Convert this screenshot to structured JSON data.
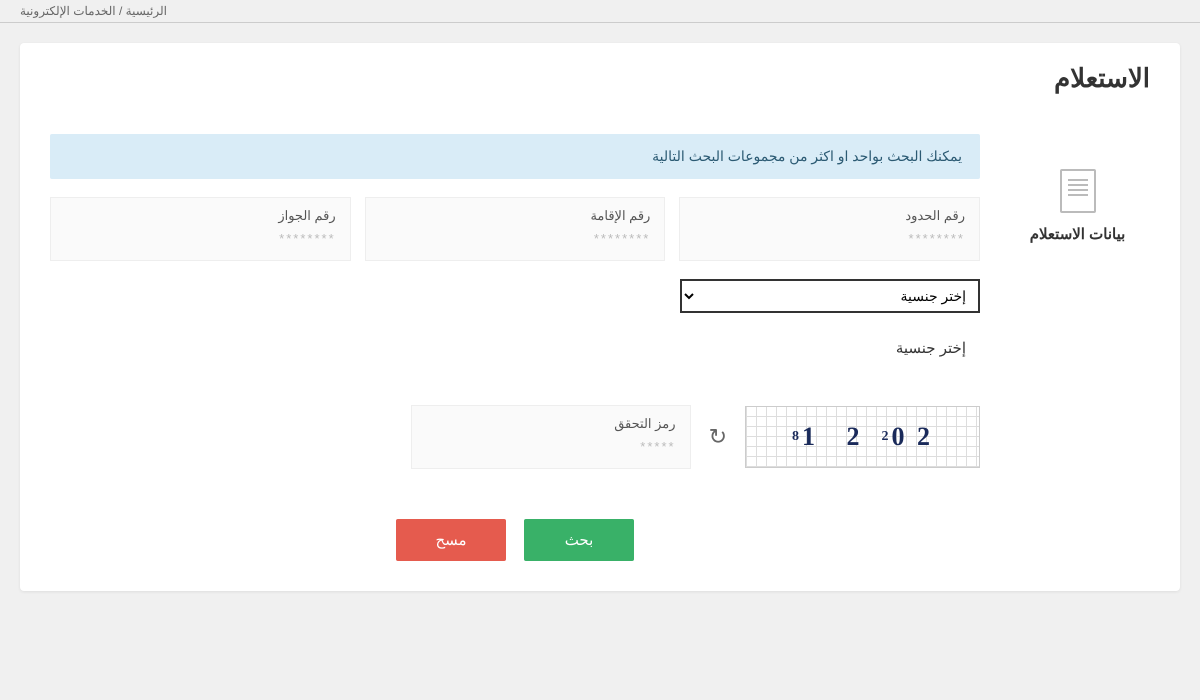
{
  "breadcrumb": "الرئيسية / الخدمات الإلكترونية",
  "page_title": "الاستعلام",
  "sidebar": {
    "label": "بيانات الاستعلام"
  },
  "info_bar": "يمكنك البحث بواحد او اكثر من مجموعات البحث التالية",
  "fields": {
    "border": {
      "label": "رقم الحدود",
      "placeholder": "********"
    },
    "iqama": {
      "label": "رقم الإقامة",
      "placeholder": "********"
    },
    "passport": {
      "label": "رقم الجواز",
      "placeholder": "********"
    }
  },
  "nationality": {
    "selected": "إختر جنسية",
    "helper": "إختر جنسية"
  },
  "captcha": {
    "label": "رمز التحقق",
    "placeholder": "*****",
    "display_html": "2 0<sup>2</sup>&nbsp; 2&nbsp;&nbsp; 1<sup>8</sup>"
  },
  "buttons": {
    "search": "بحث",
    "clear": "مسح"
  }
}
